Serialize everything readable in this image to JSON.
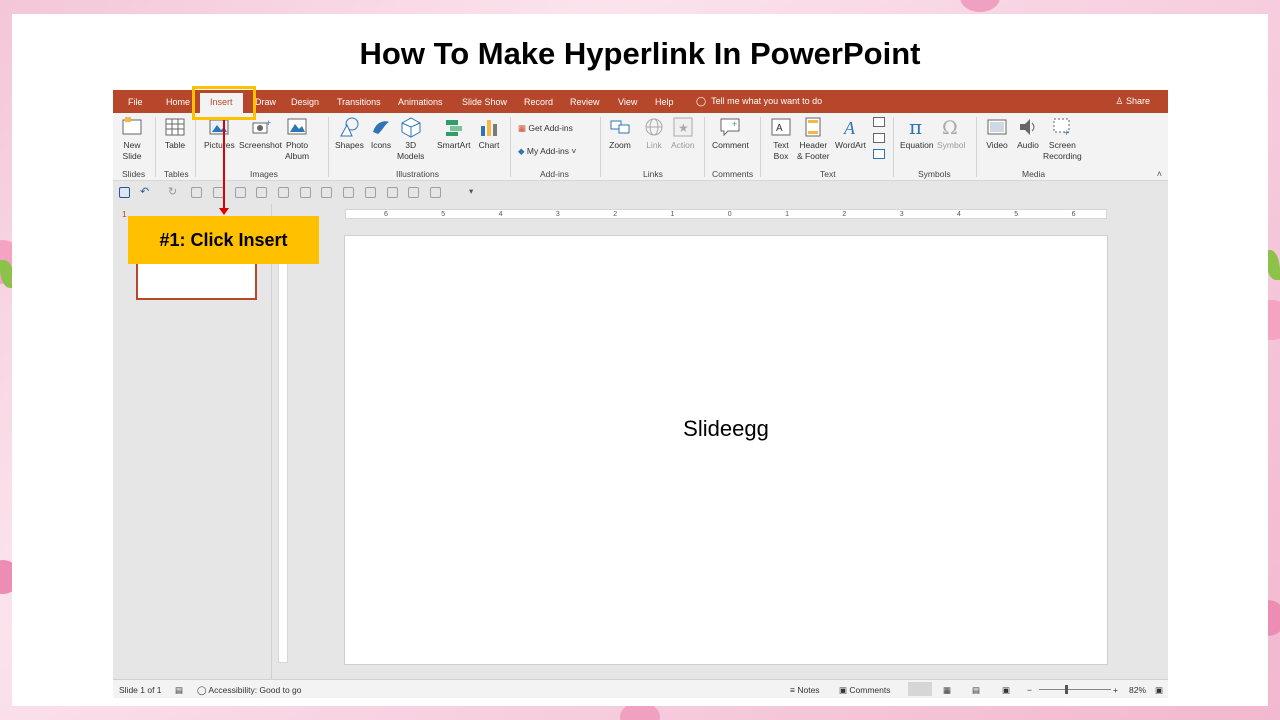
{
  "page_title": "How To Make Hyperlink In PowerPoint",
  "tabs": {
    "file": "File",
    "items": [
      "Home",
      "Insert",
      "Draw",
      "Design",
      "Transitions",
      "Animations",
      "Slide Show",
      "Record",
      "Review",
      "View",
      "Help"
    ],
    "active": "Insert",
    "tell_me": "Tell me what you want to do",
    "share": "Share"
  },
  "ribbon": {
    "slides": {
      "new_slide_1": "New",
      "new_slide_2": "Slide",
      "group": "Slides"
    },
    "tables": {
      "table": "Table",
      "group": "Tables"
    },
    "images": {
      "pictures": "Pictures",
      "screenshot": "Screenshot",
      "photo_album_1": "Photo",
      "photo_album_2": "Album",
      "group": "Images"
    },
    "illustrations": {
      "shapes": "Shapes",
      "icons": "Icons",
      "models_1": "3D",
      "models_2": "Models",
      "smartart": "SmartArt",
      "chart": "Chart",
      "group": "Illustrations"
    },
    "addins": {
      "get": "Get Add-ins",
      "my": "My Add-ins",
      "group": "Add-ins"
    },
    "links": {
      "zoom": "Zoom",
      "link": "Link",
      "action": "Action",
      "group": "Links"
    },
    "comments": {
      "comment": "Comment",
      "group": "Comments"
    },
    "text": {
      "textbox_1": "Text",
      "textbox_2": "Box",
      "header_1": "Header",
      "header_2": "& Footer",
      "wordart": "WordArt",
      "group": "Text"
    },
    "symbols": {
      "equation": "Equation",
      "symbol": "Symbol",
      "group": "Symbols"
    },
    "media": {
      "video": "Video",
      "audio": "Audio",
      "screen_rec_1": "Screen",
      "screen_rec_2": "Recording",
      "group": "Media"
    }
  },
  "thumbnail_number": "1",
  "ruler_labels": [
    "6",
    "5",
    "4",
    "3",
    "2",
    "1",
    "0",
    "1",
    "2",
    "3",
    "4",
    "5",
    "6"
  ],
  "slide_text": "Slideegg",
  "status": {
    "slide_of": "Slide 1 of 1",
    "accessibility": "Accessibility: Good to go",
    "notes": "Notes",
    "comments": "Comments",
    "zoom": "82%"
  },
  "callout": "#1: Click Insert",
  "colors": {
    "accent": "#b7472a",
    "highlight": "#ffc000",
    "arrow": "#dd0000"
  }
}
